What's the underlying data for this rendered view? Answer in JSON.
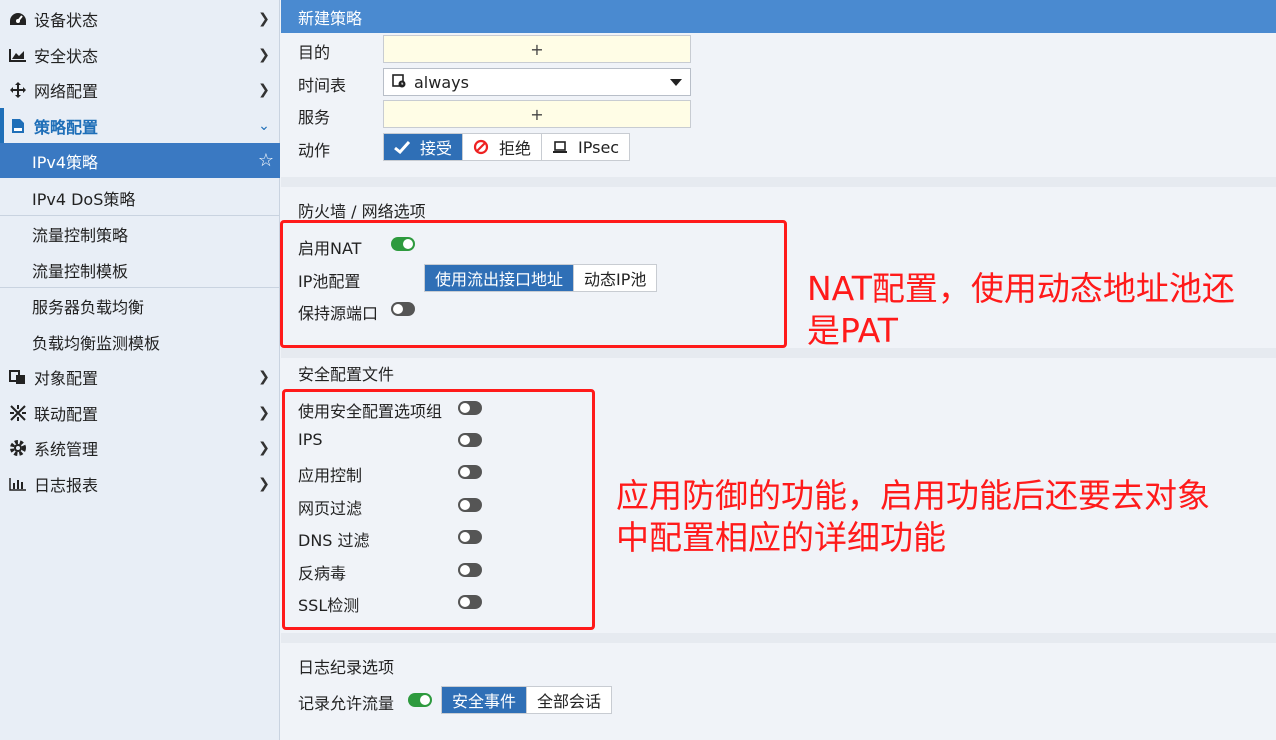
{
  "sidebar": {
    "items": [
      {
        "label": "设备状态",
        "icon": "dashboard-icon"
      },
      {
        "label": "安全状态",
        "icon": "area-chart-icon"
      },
      {
        "label": "网络配置",
        "icon": "move-arrows-icon"
      },
      {
        "label": "策略配置",
        "icon": "policy-doc-icon"
      },
      {
        "label": "对象配置",
        "icon": "object-icon"
      },
      {
        "label": "联动配置",
        "icon": "linkage-icon"
      },
      {
        "label": "系统管理",
        "icon": "gear-icon"
      },
      {
        "label": "日志报表",
        "icon": "bar-chart-icon"
      }
    ],
    "sub": [
      {
        "label": "IPv4策略"
      },
      {
        "label": "IPv4 DoS策略"
      },
      {
        "label": "流量控制策略"
      },
      {
        "label": "流量控制模板"
      },
      {
        "label": "服务器负载均衡"
      },
      {
        "label": "负载均衡监测模板"
      }
    ]
  },
  "main": {
    "title": "新建策略",
    "dest_label": "目的",
    "dest_plus": "+",
    "schedule_label": "时间表",
    "schedule_value": "always",
    "service_label": "服务",
    "service_plus": "+",
    "action_label": "动作",
    "actions": [
      "接受",
      "拒绝",
      "IPsec"
    ],
    "fw_section": "防火墙 / 网络选项",
    "nat_label": "启用NAT",
    "ippool_label": "IP池配置",
    "ippool_options": [
      "使用流出接口地址",
      "动态IP池"
    ],
    "keep_port_label": "保持源端口",
    "sec_section": "安全配置文件",
    "sec_items": [
      "使用安全配置选项组",
      "IPS",
      "应用控制",
      "网页过滤",
      "DNS 过滤",
      "反病毒",
      "SSL检测"
    ],
    "log_section": "日志纪录选项",
    "log_allowed_label": "记录允许流量",
    "log_options": [
      "安全事件",
      "全部会话"
    ]
  },
  "annotations": {
    "nat_note": "NAT配置，使用动态地址池还是PAT",
    "sec_note": "应用防御的功能，启用功能后还要去对象中配置相应的详细功能"
  },
  "colors": {
    "accent": "#3a79c2",
    "annotation": "#ff1a1a",
    "toggle_on": "#2e9a3e"
  }
}
